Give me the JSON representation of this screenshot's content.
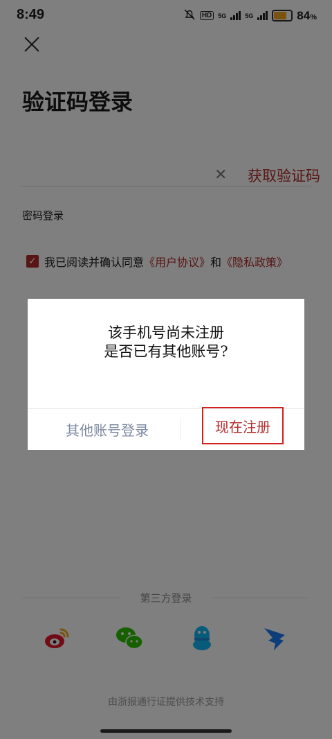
{
  "status_bar": {
    "time": "8:49",
    "network1": "5G",
    "network2": "5G",
    "battery": "84",
    "battery_unit": "%",
    "hd": "HD"
  },
  "page": {
    "title": "验证码登录",
    "get_code": "获取验证码",
    "password_login": "密码登录",
    "agreement": {
      "prefix": "我已阅读并确认同意",
      "user_agreement": "《用户协议》",
      "and": "和",
      "privacy": "《隐私政策》"
    },
    "third_party_label": "第三方登录",
    "footer": "由浙报通行证提供技术支持"
  },
  "dialog": {
    "line1": "该手机号尚未注册",
    "line2": "是否已有其他账号?",
    "other_login": "其他账号登录",
    "register_now": "现在注册"
  },
  "colors": {
    "accent": "#b32a2a",
    "highlight_border": "#d31f1f",
    "overlay": "rgba(0,0,0,0.5)"
  },
  "icons": [
    "close-icon",
    "weibo-icon",
    "wechat-icon",
    "qq-icon",
    "dingtalk-icon",
    "clear-icon",
    "checkbox-checked-icon"
  ]
}
